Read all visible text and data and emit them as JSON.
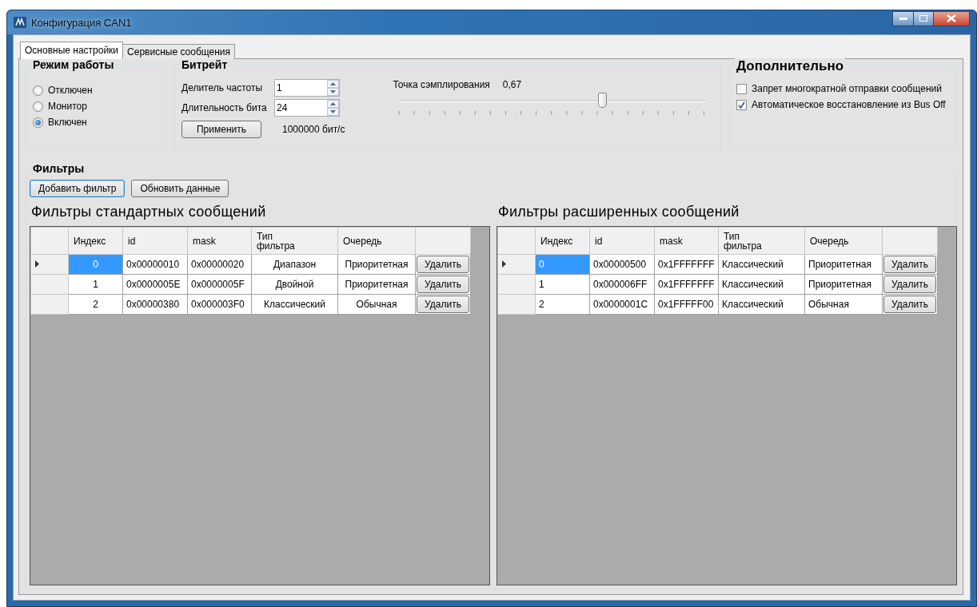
{
  "window": {
    "title": "Конфигурация CAN1"
  },
  "tabs": [
    {
      "label": "Основные настройки",
      "selected": true
    },
    {
      "label": "Сервисные сообщения",
      "selected": false
    }
  ],
  "mode": {
    "title": "Режим работы",
    "options": [
      {
        "label": "Отключен",
        "selected": false
      },
      {
        "label": "Монитор",
        "selected": false
      },
      {
        "label": "Включен",
        "selected": true
      }
    ]
  },
  "bitrate": {
    "title": "Битрейт",
    "fields": [
      {
        "label": "Делитель частоты",
        "value": "1"
      },
      {
        "label": "Длительность бита",
        "value": "24"
      }
    ],
    "apply_button": "Применить",
    "result": "1000000 бит/с",
    "sampling_label": "Точка сэмплирования",
    "sampling_value": "0,67",
    "slider": {
      "level": 0.66
    }
  },
  "extra": {
    "title": "Дополнительно",
    "options": [
      {
        "label": "Запрет многократной отправки сообщений",
        "checked": false
      },
      {
        "label": "Автоматическое восстановление из Bus Off",
        "checked": true
      }
    ]
  },
  "filters": {
    "title": "Фильтры",
    "buttons": [
      {
        "label": "Добавить фильтр",
        "focused": true
      },
      {
        "label": "Обновить данные",
        "focused": false
      }
    ],
    "tables": [
      {
        "title": "Фильтры стандартных сообщений",
        "kind": "standard",
        "columns": [
          "Индекс",
          "id",
          "mask",
          "Тип фильтра",
          "Очередь"
        ],
        "rows": [
          {
            "selected": true,
            "cells": [
              "0",
              "0x00000010",
              "0x00000020",
              "Диапазон",
              "Приоритетная"
            ],
            "action": "Удалить"
          },
          {
            "selected": false,
            "cells": [
              "1",
              "0x0000005E",
              "0x0000005F",
              "Двойной",
              "Приоритетная"
            ],
            "action": "Удалить"
          },
          {
            "selected": false,
            "cells": [
              "2",
              "0x00000380",
              "0x000003F0",
              "Классический",
              "Обычная"
            ],
            "action": "Удалить"
          }
        ]
      },
      {
        "title": "Фильтры расширенных сообщений",
        "kind": "extended",
        "columns": [
          "Индекс",
          "id",
          "mask",
          "Тип фильтра",
          "Очередь"
        ],
        "rows": [
          {
            "selected": true,
            "cells": [
              "0",
              "0x00000500",
              "0x1FFFFFFF",
              "Классический",
              "Приоритетная"
            ],
            "action": "Удалить"
          },
          {
            "selected": false,
            "cells": [
              "1",
              "0x000006FF",
              "0x1FFFFFFF",
              "Классический",
              "Приоритетная"
            ],
            "action": "Удалить"
          },
          {
            "selected": false,
            "cells": [
              "2",
              "0x0000001C",
              "0x1FFFFF00",
              "Классический",
              "Обычная"
            ],
            "action": "Удалить"
          }
        ]
      }
    ]
  }
}
